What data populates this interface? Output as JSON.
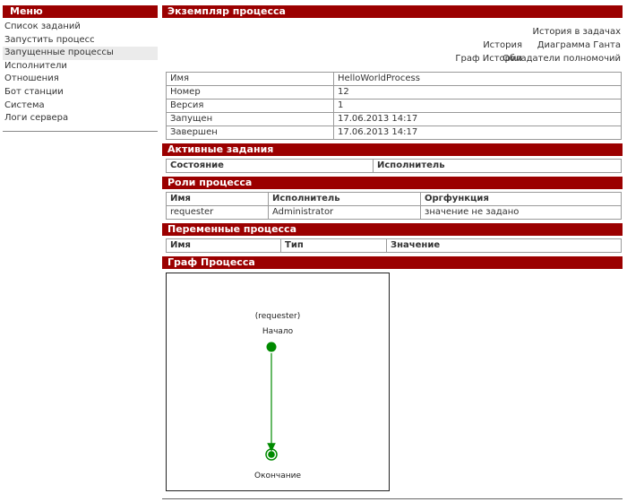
{
  "sidebar": {
    "title": "Меню",
    "items": [
      {
        "label": "Список заданий"
      },
      {
        "label": "Запустить процесс"
      },
      {
        "label": "Запущенные процессы",
        "active": true
      },
      {
        "label": "Исполнители"
      },
      {
        "label": "Отношения"
      },
      {
        "label": "Бот станции"
      },
      {
        "label": "Система"
      },
      {
        "label": "Логи сервера"
      }
    ]
  },
  "process": {
    "title": "Экземпляр процесса",
    "links": {
      "task_history": "История в задачах",
      "history": "История",
      "gantt": "Диаграмма Ганта",
      "history_graph": "Граф Истории",
      "permissions": "Обладатели полномочий"
    },
    "info": [
      {
        "label": "Имя",
        "value": "HelloWorldProcess"
      },
      {
        "label": "Номер",
        "value": "12"
      },
      {
        "label": "Версия",
        "value": "1"
      },
      {
        "label": "Запущен",
        "value": "17.06.2013 14:17"
      },
      {
        "label": "Завершен",
        "value": "17.06.2013 14:17"
      }
    ]
  },
  "active_tasks": {
    "title": "Активные задания",
    "columns": [
      "Состояние",
      "Исполнитель"
    ]
  },
  "roles": {
    "title": "Роли процесса",
    "columns": [
      "Имя",
      "Исполнитель",
      "Оргфункция"
    ],
    "rows": [
      [
        "requester",
        "Administrator",
        "значение не задано"
      ]
    ]
  },
  "variables": {
    "title": "Переменные процесса",
    "columns": [
      "Имя",
      "Тип",
      "Значение"
    ]
  },
  "graph": {
    "title": "Граф Процесса",
    "start_role": "(requester)",
    "start_label": "Начало",
    "end_label": "Окончание",
    "node_color": "#008a00"
  }
}
